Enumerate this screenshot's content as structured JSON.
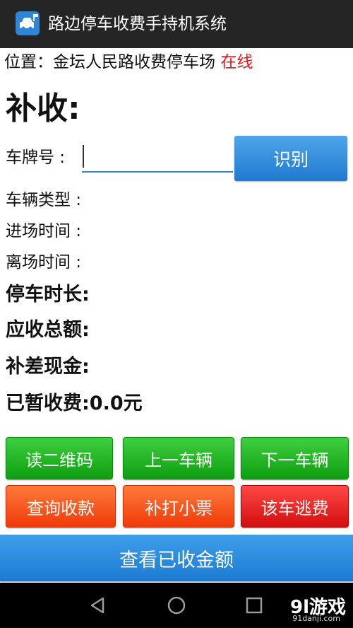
{
  "app": {
    "title": "路边停车收费手持机系统",
    "icon": "parking-car-icon"
  },
  "location": {
    "label": "位置：",
    "name": "金坛人民路收费停车场",
    "status": "在线",
    "status_color": "#e01818"
  },
  "form": {
    "section_title": "补收:",
    "plate_label": "车牌号 :",
    "plate_value": "",
    "identify_button": "识别"
  },
  "info": {
    "vehicle_type": "车辆类型 :",
    "entry_time": "进场时间 :",
    "exit_time": "离场时间 :",
    "duration": "停车时长:",
    "total_due": "应收总额:",
    "cash_diff": "补差现金:",
    "prepaid": "已暂收费:0.0元"
  },
  "buttons": {
    "read_qr": "读二维码",
    "prev_vehicle": "上一车辆",
    "next_vehicle": "下一车辆",
    "query_payment": "查询收款",
    "reprint_ticket": "补打小票",
    "evade_fee": "该车逃费",
    "view_collected": "查看已收金额"
  },
  "colors": {
    "titlebar": "#252525",
    "green": "#19a819",
    "orange": "#f5501a",
    "red": "#e01818",
    "blue": "#2a8ddf"
  },
  "watermark": {
    "logo": "9l游戏",
    "site": "91danji.com"
  }
}
